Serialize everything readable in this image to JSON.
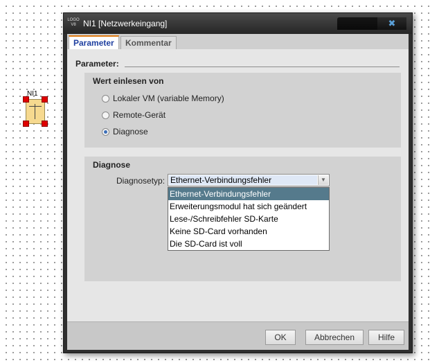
{
  "canvas": {
    "block_label": "NI1",
    "block_symbol": "I"
  },
  "dialog": {
    "app_logo_line1": "LOGO",
    "app_logo_line2": "V8",
    "title": "NI1 [Netzwerkeingang]",
    "close_glyph": "✖",
    "tabs": [
      {
        "label": "Parameter",
        "active": true
      },
      {
        "label": "Kommentar",
        "active": false
      }
    ],
    "parameter_heading": "Parameter:",
    "read_group": {
      "title": "Wert einlesen von",
      "options": [
        {
          "label": "Lokaler VM (variable Memory)",
          "checked": false
        },
        {
          "label": "Remote-Gerät",
          "checked": false
        },
        {
          "label": "Diagnose",
          "checked": true
        }
      ]
    },
    "diagnose_group": {
      "title": "Diagnose",
      "select_label": "Diagnosetyp:",
      "select_value": "Ethernet-Verbindungsfehler",
      "options": [
        "Ethernet-Verbindungsfehler",
        "Erweiterungsmodul hat sich geändert",
        "Lese-/Schreibfehler SD-Karte",
        "Keine SD-Card vorhanden",
        "Die SD-Card ist voll"
      ],
      "highlighted_option_index": 0
    },
    "buttons": {
      "ok": "OK",
      "cancel": "Abbrechen",
      "help": "Hilfe"
    }
  },
  "colors": {
    "dialog_frame": "#2f2f2f",
    "active_tab_text": "#1e3fa0",
    "active_tab_accent": "#e07a10",
    "selected_option": "#557a8c",
    "block_fill": "#f6d98f",
    "handle": "#e00000"
  }
}
